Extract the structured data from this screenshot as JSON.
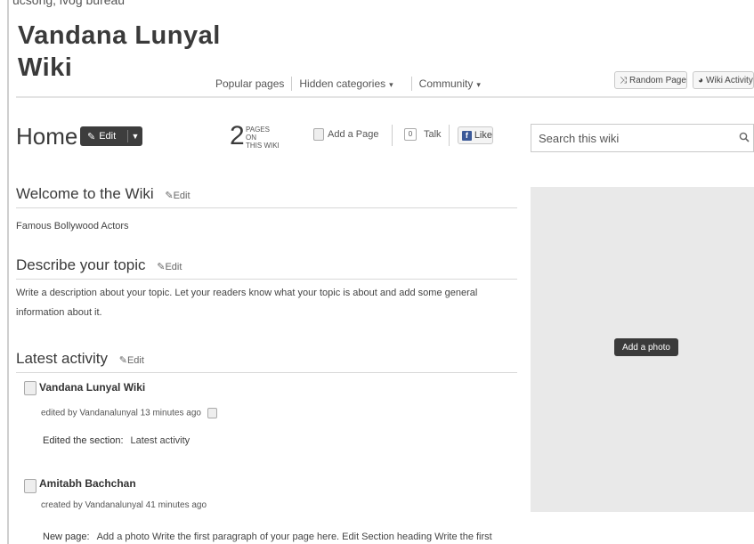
{
  "cropped_top_text": "ucsong, ivog bureau",
  "wiki": {
    "title_line1": "Vandana Lunyal",
    "title_line2": "Wiki"
  },
  "topnav": {
    "popular": "Popular pages",
    "hidden": "Hidden categories",
    "community": "Community"
  },
  "header_buttons": {
    "random": "Random Page",
    "activity": "Wiki Activity"
  },
  "page": {
    "title": "Home",
    "edit_label": "Edit",
    "pages_count": "2",
    "pages_line1": "PAGES ON",
    "pages_line2": "THIS WIKI",
    "add_page": "Add a Page",
    "talk_count": "0",
    "talk": "Talk",
    "like": "Like"
  },
  "search": {
    "placeholder": "Search this wiki"
  },
  "sections": {
    "welcome_heading": "Welcome to the Wiki",
    "welcome_text": "Famous Bollywood Actors",
    "describe_heading": "Describe your topic",
    "describe_text": "Write a description about your topic. Let your readers know what your topic is about and add some general information about it.",
    "activity_heading": "Latest activity",
    "edit_link": "Edit"
  },
  "activity": [
    {
      "title": "Vandana Lunyal Wiki",
      "meta": "edited by Vandanalunyal 13 minutes ago",
      "detail_key": "Edited the section:",
      "detail_value": "Latest activity"
    },
    {
      "title": "Amitabh Bachchan",
      "meta": "created by Vandanalunyal 41 minutes ago",
      "detail_key": "New page:",
      "detail_value": "Add a photo Write the first paragraph of your page here. Edit Section heading Write the first"
    }
  ],
  "sidebar": {
    "add_photo": "Add a photo"
  },
  "colors": {
    "dark_button": "#3d3d3d",
    "photo_panel": "#e9e9e9",
    "facebook": "#3b5998"
  }
}
